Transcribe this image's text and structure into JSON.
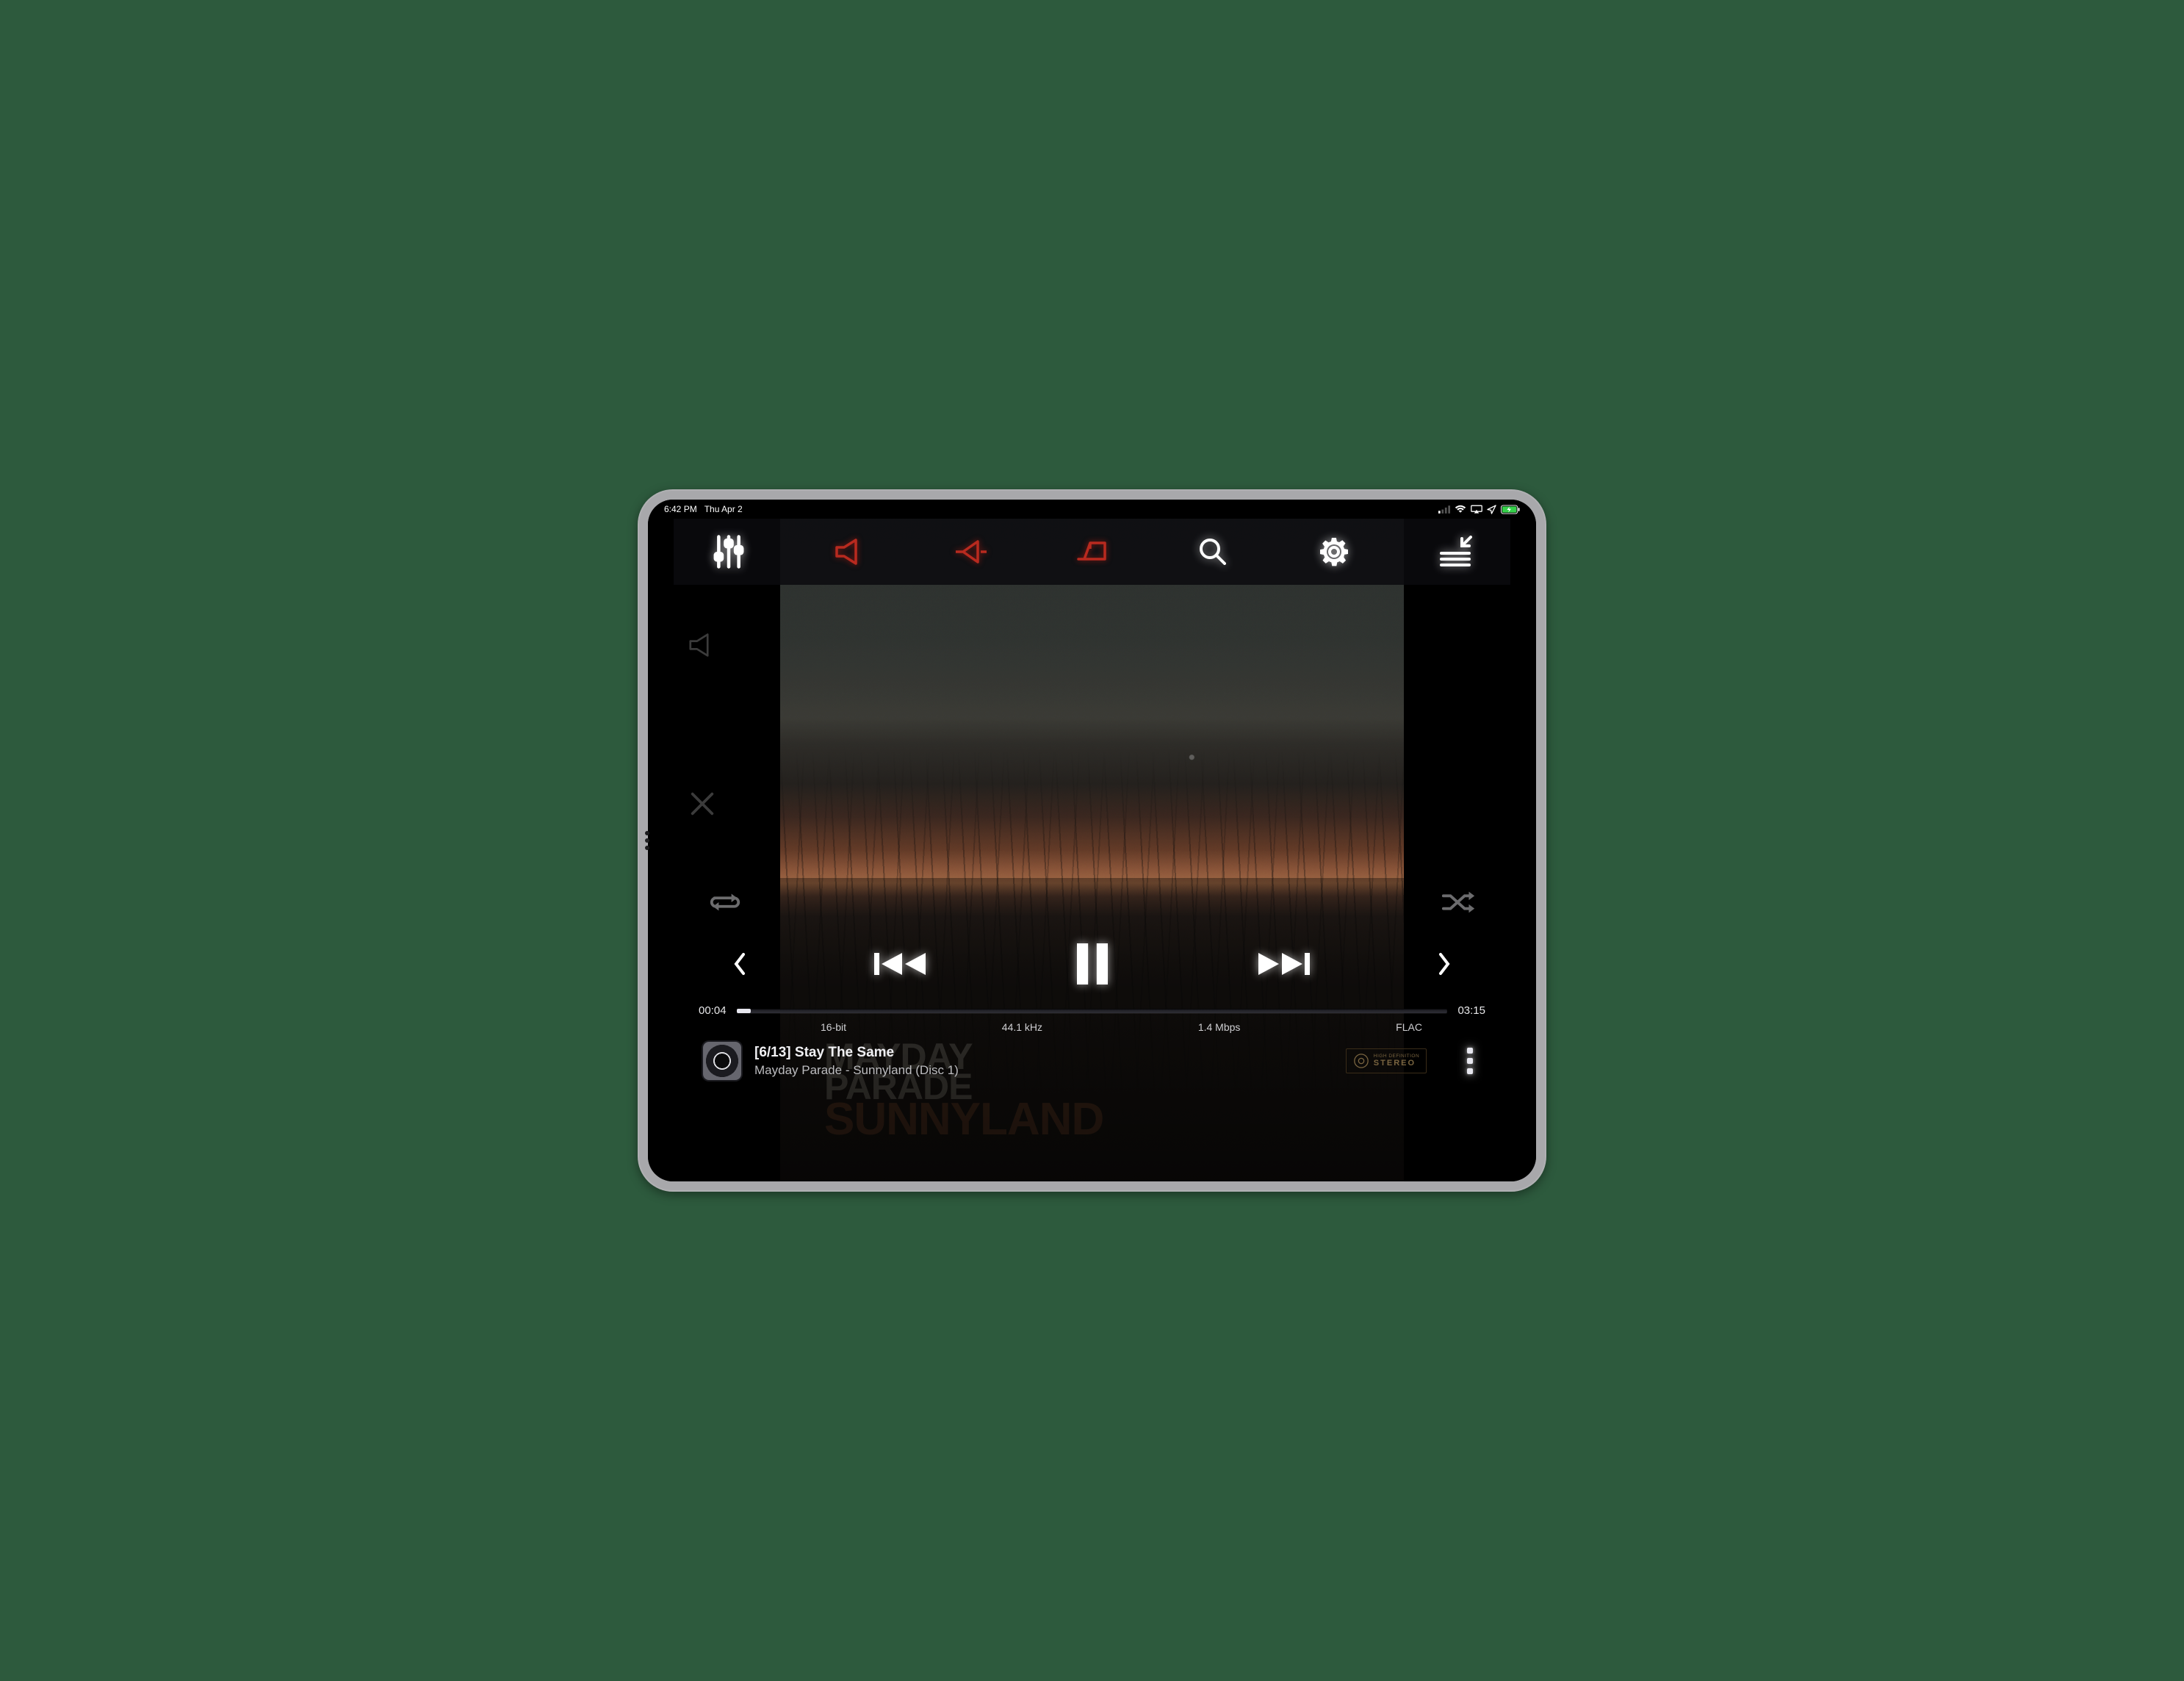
{
  "statusbar": {
    "time": "6:42 PM",
    "date": "Thu Apr 2"
  },
  "toolbar": {
    "icons": [
      "equalizer",
      "speaker",
      "amp",
      "dac",
      "search",
      "settings",
      "collapse"
    ]
  },
  "playback": {
    "elapsed": "00:04",
    "duration": "03:15",
    "progress_pct": 2
  },
  "format": {
    "bit_depth": "16-bit",
    "sample_rate": "44.1 kHz",
    "bitrate": "1.4 Mbps",
    "codec": "FLAC"
  },
  "track": {
    "index": "[6/13]",
    "title": "Stay The Same",
    "artist": "Mayday Parade",
    "album": "Sunnyland (Disc 1)"
  },
  "album_art_text": {
    "artist_line1": "MAYDAY",
    "artist_line2": "PARADE",
    "album": "SUNNYLAND"
  },
  "hd_badge": {
    "top": "HIGH DEFINITION",
    "bottom": "STEREO"
  }
}
